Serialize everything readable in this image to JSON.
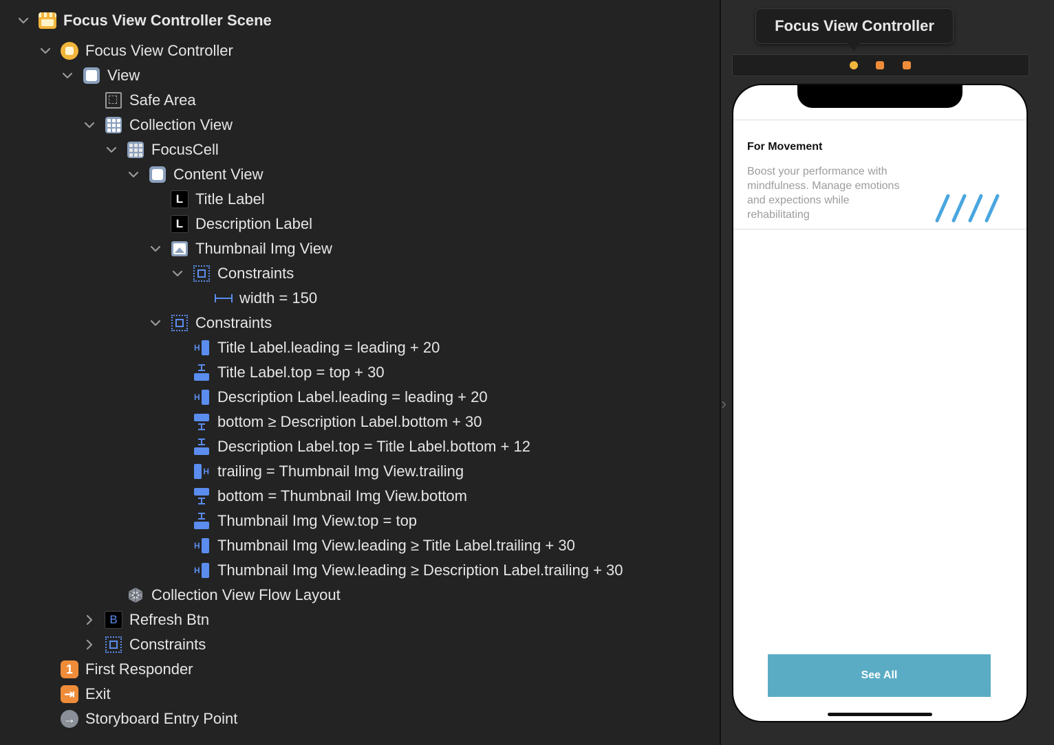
{
  "outline": {
    "rows": [
      {
        "label": "Focus View Controller Scene",
        "icon": "scene-icon",
        "chevron": "down"
      },
      {
        "label": "Focus View Controller",
        "icon": "view-controller-icon",
        "chevron": "down"
      },
      {
        "label": "View",
        "icon": "view-icon",
        "chevron": "down"
      },
      {
        "label": "Safe Area",
        "icon": "safe-area-icon",
        "chevron": ""
      },
      {
        "label": "Collection View",
        "icon": "collection-view-icon",
        "chevron": "down"
      },
      {
        "label": "FocusCell",
        "icon": "collection-cell-icon",
        "chevron": "down"
      },
      {
        "label": "Content View",
        "icon": "view-icon",
        "chevron": "down"
      },
      {
        "label": "Title Label",
        "icon": "label-icon",
        "chevron": ""
      },
      {
        "label": "Description Label",
        "icon": "label-icon",
        "chevron": ""
      },
      {
        "label": "Thumbnail Img View",
        "icon": "image-view-icon",
        "chevron": "down"
      },
      {
        "label": "Constraints",
        "icon": "constraints-icon",
        "chevron": "down"
      },
      {
        "label": "width = 150",
        "icon": "width-constraint-icon",
        "chevron": ""
      },
      {
        "label": "Constraints",
        "icon": "constraints-icon",
        "chevron": "down"
      },
      {
        "label": "Title Label.leading = leading + 20",
        "icon": "leading-constraint-icon",
        "chevron": ""
      },
      {
        "label": "Title Label.top = top + 30",
        "icon": "top-constraint-icon",
        "chevron": ""
      },
      {
        "label": "Description Label.leading = leading + 20",
        "icon": "leading-constraint-icon",
        "chevron": ""
      },
      {
        "label": "bottom ≥ Description Label.bottom + 30",
        "icon": "bottom-constraint-icon",
        "chevron": ""
      },
      {
        "label": "Description Label.top = Title Label.bottom + 12",
        "icon": "top-constraint-icon",
        "chevron": ""
      },
      {
        "label": "trailing = Thumbnail Img View.trailing",
        "icon": "trailing-constraint-icon",
        "chevron": ""
      },
      {
        "label": "bottom = Thumbnail Img View.bottom",
        "icon": "bottom-constraint-icon",
        "chevron": ""
      },
      {
        "label": "Thumbnail Img View.top = top",
        "icon": "top-constraint-icon",
        "chevron": ""
      },
      {
        "label": "Thumbnail Img View.leading ≥ Title Label.trailing + 30",
        "icon": "leading-constraint-icon",
        "chevron": ""
      },
      {
        "label": "Thumbnail Img View.leading ≥ Description Label.trailing + 30",
        "icon": "leading-constraint-icon",
        "chevron": ""
      },
      {
        "label": "Collection View Flow Layout",
        "icon": "flow-layout-icon",
        "chevron": ""
      },
      {
        "label": "Refresh Btn",
        "icon": "button-icon",
        "chevron": "right"
      },
      {
        "label": "Constraints",
        "icon": "constraints-icon",
        "chevron": "right"
      },
      {
        "label": "First Responder",
        "icon": "first-responder-icon",
        "chevron": ""
      },
      {
        "label": "Exit",
        "icon": "exit-icon",
        "chevron": ""
      },
      {
        "label": "Storyboard Entry Point",
        "icon": "entry-point-icon",
        "chevron": ""
      }
    ],
    "label_glyph": "L",
    "button_glyph": "B",
    "first_responder_glyph": "1",
    "exit_glyph": "⇥",
    "entry_glyph": "→"
  },
  "canvas": {
    "scene_title": "Focus View Controller",
    "cell": {
      "title": "For Movement",
      "description": "Boost your performance with mindfulness. Manage emotions and expections while rehabilitating"
    },
    "button_label": "See All"
  },
  "colors": {
    "accent_blue": "#5b8def",
    "button_teal": "#5aacc4",
    "orange": "#ef8c3a",
    "yellow": "#f2b53b"
  }
}
